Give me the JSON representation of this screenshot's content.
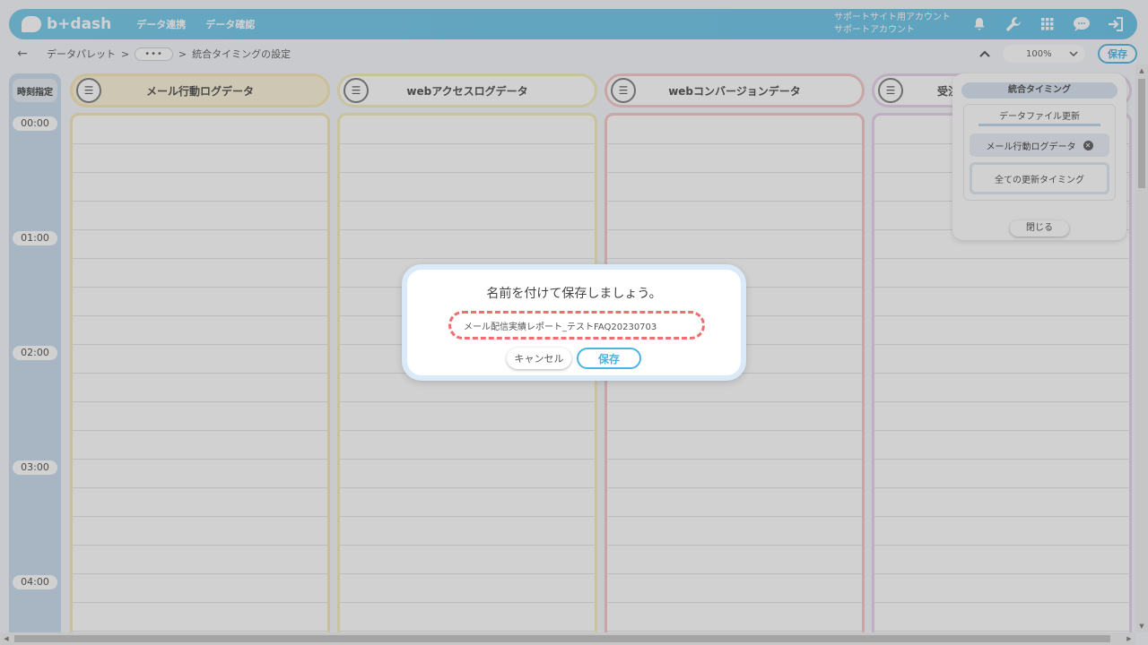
{
  "header": {
    "logo_text": "b+dash",
    "nav": [
      "データ連携",
      "データ確認"
    ],
    "account_line1": "サポートサイト用アカウント",
    "account_line2": "サポートアカウント",
    "icons": [
      "bell-icon",
      "wrench-icon",
      "grid-icon",
      "chat-icon",
      "logout-icon"
    ]
  },
  "breadcrumb": {
    "back": "←",
    "items": [
      "データパレット",
      "•••",
      "統合タイミングの設定"
    ],
    "sep": ">",
    "zoom": "100%",
    "save_label": "保存"
  },
  "time_column": {
    "header": "時刻指定",
    "labels": [
      "00:00",
      "01:00",
      "02:00",
      "03:00",
      "04:00"
    ]
  },
  "columns": [
    {
      "title": "メール行動ログデータ"
    },
    {
      "title": "webアクセスログデータ"
    },
    {
      "title": "webコンバージョンデータ"
    },
    {
      "title": "受注"
    }
  ],
  "side_panel": {
    "title": "統合タイミング",
    "subtitle": "データファイル更新",
    "chip": "メール行動ログデータ",
    "all_timing": "全ての更新タイミング",
    "close_label": "閉じる"
  },
  "dialog": {
    "title": "名前を付けて保存しましょう。",
    "input_value": "メール配信実績レポート_テストFAQ20230703",
    "cancel_label": "キャンセル",
    "save_label": "保存"
  },
  "colors": {
    "brand": "#5fbfe6",
    "highlight_dash": "#ef6f6f"
  }
}
